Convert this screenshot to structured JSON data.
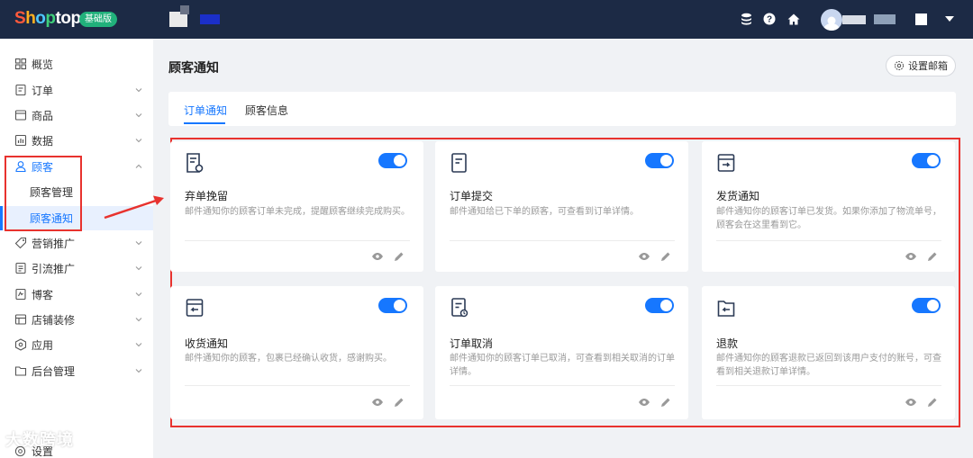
{
  "brand": {
    "logo_parts": [
      "S",
      "h",
      "o",
      "p",
      "t",
      "o",
      "p"
    ],
    "edition_badge": "基础版"
  },
  "topbar": {
    "icons": [
      "database-icon",
      "help-icon",
      "home-icon",
      "avatar"
    ]
  },
  "sidebar": {
    "items": [
      {
        "label": "概览",
        "icon": "dashboard-icon",
        "has_chevron": false
      },
      {
        "label": "订单",
        "icon": "order-icon",
        "has_chevron": true
      },
      {
        "label": "商品",
        "icon": "product-icon",
        "has_chevron": true
      },
      {
        "label": "数据",
        "icon": "chart-icon",
        "has_chevron": true
      },
      {
        "label": "顾客",
        "icon": "user-icon",
        "has_chevron": true,
        "expanded": true
      },
      {
        "label": "营销推广",
        "icon": "tag-icon",
        "has_chevron": true
      },
      {
        "label": "引流推广",
        "icon": "traffic-icon",
        "has_chevron": true
      },
      {
        "label": "博客",
        "icon": "blog-icon",
        "has_chevron": true
      },
      {
        "label": "店铺装修",
        "icon": "store-icon",
        "has_chevron": true
      },
      {
        "label": "应用",
        "icon": "app-icon",
        "has_chevron": true
      },
      {
        "label": "后台管理",
        "icon": "folder-icon",
        "has_chevron": true
      }
    ],
    "subitems": [
      {
        "label": "顾客管理",
        "selected": false
      },
      {
        "label": "顾客通知",
        "selected": true
      }
    ],
    "settings_label": "设置",
    "watermark": "大数跨境"
  },
  "main": {
    "page_title": "顾客通知",
    "set_mailbox_label": "设置邮箱",
    "tabs": [
      {
        "label": "订单通知",
        "active": true
      },
      {
        "label": "顾客信息",
        "active": false
      }
    ],
    "cards": [
      {
        "title": "弃单挽留",
        "desc": "邮件通知你的顾客订单未完成，提醒顾客继续完成购买。",
        "icon": "abandoned-cart-icon",
        "enabled": true
      },
      {
        "title": "订单提交",
        "desc": "邮件通知给已下单的顾客，可查看到订单详情。",
        "icon": "order-submit-icon",
        "enabled": true
      },
      {
        "title": "发货通知",
        "desc": "邮件通知你的顾客订单已发货。如果你添加了物流单号，顾客会在这里看到它。",
        "icon": "shipping-icon",
        "enabled": true
      },
      {
        "title": "收货通知",
        "desc": "邮件通知你的顾客，包裹已经确认收货，感谢购买。",
        "icon": "delivery-icon",
        "enabled": true
      },
      {
        "title": "订单取消",
        "desc": "邮件通知你的顾客订单已取消，可查看到相关取消的订单详情。",
        "icon": "order-cancel-icon",
        "enabled": true
      },
      {
        "title": "退款",
        "desc": "邮件通知你的顾客退款已返回到该用户支付的账号，可查看到相关退款订单详情。",
        "icon": "refund-icon",
        "enabled": true
      }
    ]
  },
  "colors": {
    "topbar_bg": "#1c2a45",
    "accent": "#1677ff",
    "highlight": "#e8322e",
    "edition_badge": "#21b17b"
  }
}
